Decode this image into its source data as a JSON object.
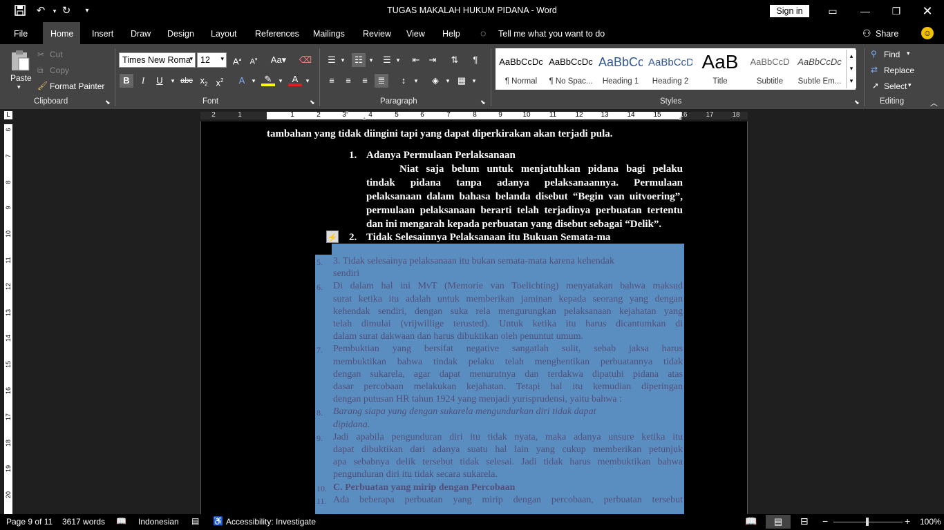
{
  "window": {
    "title": "TUGAS MAKALAH HUKUM PIDANA  -  Word",
    "sign_in": "Sign in"
  },
  "tabs": [
    "File",
    "Home",
    "Insert",
    "Draw",
    "Design",
    "Layout",
    "References",
    "Mailings",
    "Review",
    "View",
    "Help"
  ],
  "tell_me": "Tell me what you want to do",
  "share": "Share",
  "clipboard": {
    "paste": "Paste",
    "cut": "Cut",
    "copy": "Copy",
    "format_painter": "Format Painter",
    "label": "Clipboard"
  },
  "font": {
    "name": "Times New Roma",
    "size": "12",
    "label": "Font"
  },
  "paragraph": {
    "label": "Paragraph"
  },
  "styles": {
    "label": "Styles",
    "items": [
      {
        "preview": "AaBbCcDc",
        "name": "¶ Normal"
      },
      {
        "preview": "AaBbCcDc",
        "name": "¶ No Spac..."
      },
      {
        "preview": "AaBbCc",
        "name": "Heading 1"
      },
      {
        "preview": "AaBbCcD",
        "name": "Heading 2"
      },
      {
        "preview": "AaB",
        "name": "Title"
      },
      {
        "preview": "AaBbCcD",
        "name": "Subtitle"
      },
      {
        "preview": "AaBbCcDc",
        "name": "Subtle Em..."
      }
    ]
  },
  "editing": {
    "find": "Find",
    "replace": "Replace",
    "select": "Select",
    "label": "Editing"
  },
  "ruler": {
    "h_numbers": [
      "2",
      "1",
      "1",
      "2",
      "3",
      "4",
      "5",
      "6",
      "7",
      "8",
      "9",
      "10",
      "11",
      "12",
      "13",
      "14",
      "15",
      "16",
      "17",
      "18"
    ],
    "v_numbers": [
      "6",
      "7",
      "8",
      "9",
      "10",
      "11",
      "12",
      "13",
      "14",
      "15",
      "16",
      "17",
      "18",
      "19",
      "20"
    ]
  },
  "document": {
    "intro_line1": "tambahan yang tidak diingini tapi yang dapat diperkirakan akan terjadi pula.",
    "item1_num": "1.",
    "item1_head": "Adanya Permulaan Perlaksanaan",
    "item1_lines": [
      "Niat saja belum untuk menjatuhkan pidana bagi pelaku",
      "tindak pidana tanpa adanya pelaksanaannya. Permulaan",
      "pelaksanaan dalam bahasa belanda disebut “Begin van uitvoering”,",
      "permulaan pelaksanaan berarti telah terjadinya perbuatan tertentu",
      "dan ini mengarah kepada perbuatan yang disebut sebagai “Delik”."
    ],
    "item2_num": "2.",
    "item2_head": "Tidak Selesainnya Pelaksanaan itu Bukuan Semata-ma",
    "pasted_lines": [
      {
        "n": "5.",
        "t": "3.    Tidak selesainya pelaksanaan itu bukan semata-mata karena kehendak"
      },
      {
        "n": "",
        "t": "sendiri"
      },
      {
        "n": "6.",
        "t": "Di dalam hal ini MvT (Memorie van Toelichting) menyatakan bahwa maksud"
      },
      {
        "n": "",
        "t": "surat ketika itu adalah untuk memberikan jaminan kepada seorang yang dengan"
      },
      {
        "n": "",
        "t": "kehendak sendiri, dengan suka rela mengurungkan pelaksanaan kejahatan yang"
      },
      {
        "n": "",
        "t": "telah dimulai (vrijwillige terusted). Untuk ketika itu harus dicantumkan di"
      },
      {
        "n": "",
        "t": "dalam surat dakwaan dan harus dibuktikan oleh penuntut umum."
      },
      {
        "n": "7.",
        "t": "Pembuktian yang bersifat negative sangatlah sulit, sebab jaksa harus"
      },
      {
        "n": "",
        "t": "membuktikan bahwa tindak pelaku telah menghentikan perbuatannya tidak"
      },
      {
        "n": "",
        "t": "dengan sukarela, agar dapat menurutnya dan terdakwa dipatuhi pidana atas"
      },
      {
        "n": "",
        "t": "dasar percobaan melakukan kejahatan. Tetapi hal itu kemudian diperingan"
      },
      {
        "n": "",
        "t": "dengan putusan HR tahun 1924 yang menjadi yurisprudensi, yaitu bahwa :"
      },
      {
        "n": "8.",
        "t": "        Barang siapa yang dengan sukarela mengundurkan diri tidak dapat"
      },
      {
        "n": "",
        "t": "dipidana."
      },
      {
        "n": "9.",
        "t": "Jadi apabila pengunduran diri itu tidak nyata, maka adanya unsure ketika itu"
      },
      {
        "n": "",
        "t": "dapat dibuktikan dari adanya suatu hal lain yang cukup memberikan petunjuk"
      },
      {
        "n": "",
        "t": "apa sebabnya delik tersebut tidak selesai. Jadi tidak harus membuktikan bahwa"
      },
      {
        "n": "",
        "t": "pengunduran diri itu tidak secara sukarela."
      },
      {
        "n": "10.",
        "t": "C.  Perbuatan yang mirip dengan Percobaan"
      },
      {
        "n": "11.",
        "t": "Ada beberapa perbuatan yang mirip dengan percobaan, perbuatan tersebut"
      }
    ]
  },
  "status": {
    "page": "Page 9 of 11",
    "words": "3617 words",
    "language": "Indonesian",
    "accessibility": "Accessibility: Investigate",
    "zoom": "100%"
  }
}
